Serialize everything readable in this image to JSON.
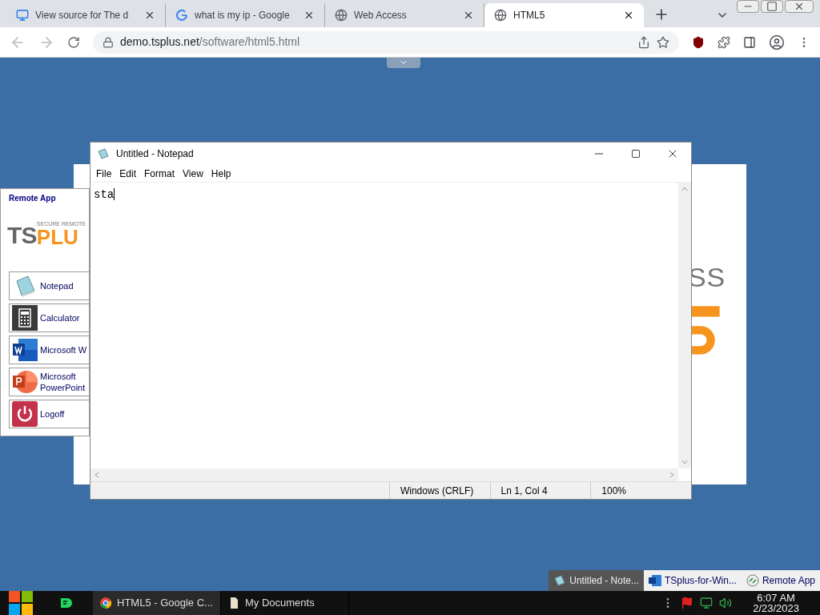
{
  "browser": {
    "tabs": [
      {
        "title": "View source for The d",
        "kind": "monitor",
        "selected": false
      },
      {
        "title": "what is my ip - Google",
        "kind": "google",
        "selected": false
      },
      {
        "title": "Web Access",
        "kind": "globe",
        "selected": false
      },
      {
        "title": "HTML5",
        "kind": "globe",
        "selected": true
      }
    ],
    "address": {
      "host": "demo.tsplus.net",
      "path": "/software/html5.html"
    }
  },
  "background_panel": {
    "text_fragment": "SS"
  },
  "remote_app": {
    "title": "Remote App",
    "logo": {
      "tagline": "SECURE REMOTE",
      "left": "TS",
      "right": "PLU"
    },
    "apps": [
      {
        "label": "Notepad",
        "kind": "notepad"
      },
      {
        "label": "Calculator",
        "kind": "calculator"
      },
      {
        "label": "Microsoft W",
        "kind": "word"
      },
      {
        "label": "Microsoft PowerPoint",
        "kind": "powerpoint"
      },
      {
        "label": "Logoff",
        "kind": "logoff"
      }
    ]
  },
  "notepad": {
    "title": "Untitled - Notepad",
    "menu": [
      "File",
      "Edit",
      "Format",
      "View",
      "Help"
    ],
    "text": "sta",
    "status": [
      "Windows (CRLF)",
      "Ln 1, Col 4",
      "100%"
    ]
  },
  "remote_taskbar": [
    {
      "label": "Untitled - Note...",
      "kind": "notepad",
      "selected": true
    },
    {
      "label": "TSplus-for-Win...",
      "kind": "word",
      "selected": false
    },
    {
      "label": "Remote App",
      "kind": "remote",
      "selected": false
    }
  ],
  "taskbar": {
    "items": [
      {
        "label": "HTML5 - Google C...",
        "kind": "chrome"
      },
      {
        "label": "My Documents",
        "kind": "folder"
      }
    ],
    "time": "6:07 AM",
    "date": "2/23/2023"
  }
}
